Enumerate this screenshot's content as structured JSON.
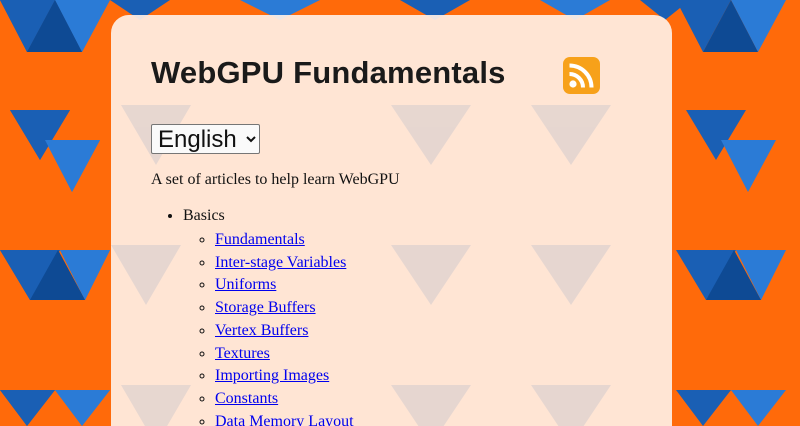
{
  "page": {
    "title": "WebGPU Fundamentals",
    "description": "A set of articles to help learn WebGPU"
  },
  "language_select": {
    "selected": "English"
  },
  "icons": {
    "rss": "rss-feed-icon"
  },
  "colors": {
    "background_orange": "#ff6a0a",
    "background_blue": "#1a5fb4",
    "rss_orange": "#f7a11a",
    "link_blue": "#0000ee"
  },
  "toc": {
    "section": "Basics",
    "items": [
      "Fundamentals",
      "Inter-stage Variables",
      "Uniforms",
      "Storage Buffers",
      "Vertex Buffers",
      "Textures",
      "Importing Images",
      "Constants",
      "Data Memory Layout"
    ]
  }
}
